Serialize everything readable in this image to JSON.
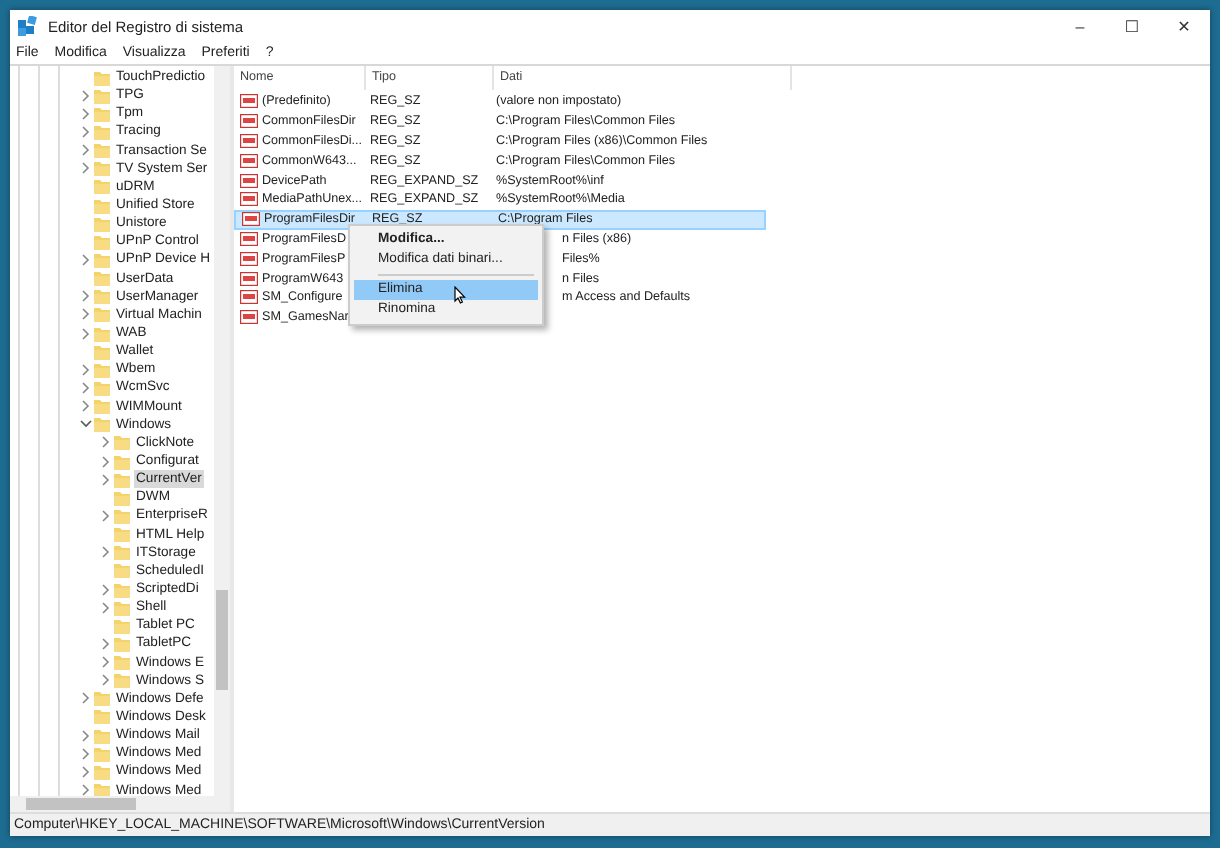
{
  "window": {
    "title": "Editor del Registro di sistema",
    "controls": [
      "–",
      "☐",
      "✕"
    ]
  },
  "menu": [
    "File",
    "Modifica",
    "Visualizza",
    "Preferiti",
    "?"
  ],
  "tree": [
    {
      "label": "TouchPredictio",
      "expandable": false,
      "selected": false
    },
    {
      "label": "TPG",
      "expandable": true,
      "expanded": false,
      "selected": false
    },
    {
      "label": "Tpm",
      "expandable": true,
      "expanded": false,
      "selected": false
    },
    {
      "label": "Tracing",
      "expandable": true,
      "expanded": false,
      "selected": false
    },
    {
      "label": "Transaction Se",
      "expandable": true,
      "expanded": false,
      "selected": false
    },
    {
      "label": "TV System Ser",
      "expandable": true,
      "expanded": false,
      "selected": false
    },
    {
      "label": "uDRM",
      "expandable": false,
      "selected": false
    },
    {
      "label": "Unified Store",
      "expandable": false,
      "selected": false
    },
    {
      "label": "Unistore",
      "expandable": false,
      "selected": false
    },
    {
      "label": "UPnP Control",
      "expandable": false,
      "selected": false
    },
    {
      "label": "UPnP Device H",
      "expandable": true,
      "expanded": false,
      "selected": false
    },
    {
      "label": "UserData",
      "expandable": false,
      "selected": false
    },
    {
      "label": "UserManager",
      "expandable": true,
      "expanded": false,
      "selected": false
    },
    {
      "label": "Virtual Machin",
      "expandable": true,
      "expanded": false,
      "selected": false
    },
    {
      "label": "WAB",
      "expandable": true,
      "expanded": false,
      "selected": false
    },
    {
      "label": "Wallet",
      "expandable": false,
      "selected": false
    },
    {
      "label": "Wbem",
      "expandable": true,
      "expanded": false,
      "selected": false
    },
    {
      "label": "WcmSvc",
      "expandable": true,
      "expanded": false,
      "selected": false
    },
    {
      "label": "WIMMount",
      "expandable": true,
      "expanded": false,
      "selected": false
    },
    {
      "label": "Windows",
      "expandable": true,
      "expanded": true,
      "selected": false,
      "children": [
        {
          "label": "ClickNote",
          "expandable": true,
          "expanded": false,
          "selected": false
        },
        {
          "label": "Configurat",
          "expandable": true,
          "expanded": false,
          "selected": false
        },
        {
          "label": "CurrentVer",
          "expandable": true,
          "expanded": false,
          "selected": true
        },
        {
          "label": "DWM",
          "expandable": false,
          "selected": false
        },
        {
          "label": "EnterpriseR",
          "expandable": true,
          "expanded": false,
          "selected": false
        },
        {
          "label": "HTML Help",
          "expandable": false,
          "selected": false
        },
        {
          "label": "ITStorage",
          "expandable": true,
          "expanded": false,
          "selected": false
        },
        {
          "label": "ScheduledI",
          "expandable": false,
          "selected": false
        },
        {
          "label": "ScriptedDi",
          "expandable": true,
          "expanded": false,
          "selected": false
        },
        {
          "label": "Shell",
          "expandable": true,
          "expanded": false,
          "selected": false
        },
        {
          "label": "Tablet PC",
          "expandable": false,
          "selected": false
        },
        {
          "label": "TabletPC",
          "expandable": true,
          "expanded": false,
          "selected": false
        },
        {
          "label": "Windows E",
          "expandable": true,
          "expanded": false,
          "selected": false
        },
        {
          "label": "Windows S",
          "expandable": true,
          "expanded": false,
          "selected": false
        }
      ]
    },
    {
      "label": "Windows Defe",
      "expandable": true,
      "expanded": false,
      "selected": false
    },
    {
      "label": "Windows Desk",
      "expandable": false,
      "selected": false
    },
    {
      "label": "Windows Mail",
      "expandable": true,
      "expanded": false,
      "selected": false
    },
    {
      "label": "Windows Med",
      "expandable": true,
      "expanded": false,
      "selected": false
    },
    {
      "label": "Windows Med",
      "expandable": true,
      "expanded": false,
      "selected": false
    },
    {
      "label": "Windows Med",
      "expandable": true,
      "expanded": false,
      "selected": false
    }
  ],
  "table": {
    "columns": [
      "Nome",
      "Tipo",
      "Dati"
    ],
    "rows": [
      {
        "name": "(Predefinito)",
        "type": "REG_SZ",
        "data": "(valore non impostato)",
        "selected": false
      },
      {
        "name": "CommonFilesDir",
        "type": "REG_SZ",
        "data": "C:\\Program Files\\Common Files",
        "selected": false
      },
      {
        "name": "CommonFilesDi...",
        "type": "REG_SZ",
        "data": "C:\\Program Files (x86)\\Common Files",
        "selected": false
      },
      {
        "name": "CommonW643...",
        "type": "REG_SZ",
        "data": "C:\\Program Files\\Common Files",
        "selected": false
      },
      {
        "name": "DevicePath",
        "type": "REG_EXPAND_SZ",
        "data": "%SystemRoot%\\inf",
        "selected": false
      },
      {
        "name": "MediaPathUnex...",
        "type": "REG_EXPAND_SZ",
        "data": "%SystemRoot%\\Media",
        "selected": false
      },
      {
        "name": "ProgramFilesDir",
        "type": "REG_SZ",
        "data": "C:\\Program Files",
        "selected": true
      },
      {
        "name": "ProgramFilesD",
        "data": "n Files (x86)",
        "selected": false
      },
      {
        "name": "ProgramFilesP",
        "data": "Files%",
        "selected": false
      },
      {
        "name": "ProgramW643",
        "data": "n Files",
        "selected": false
      },
      {
        "name": "SM_Configure",
        "data": "m Access and Defaults",
        "selected": false
      },
      {
        "name": "SM_GamesNar",
        "selected": false
      }
    ]
  },
  "context_menu": [
    {
      "label": "Modifica...",
      "kind": "default",
      "selected": false
    },
    {
      "label": "Modifica dati binari...",
      "kind": "item",
      "selected": false
    },
    {
      "kind": "separator"
    },
    {
      "label": "Elimina",
      "kind": "item",
      "selected": true
    },
    {
      "label": "Rinomina",
      "kind": "item",
      "selected": false
    }
  ],
  "status_bar": "Computer\\HKEY_LOCAL_MACHINE\\SOFTWARE\\Microsoft\\Windows\\CurrentVersion"
}
